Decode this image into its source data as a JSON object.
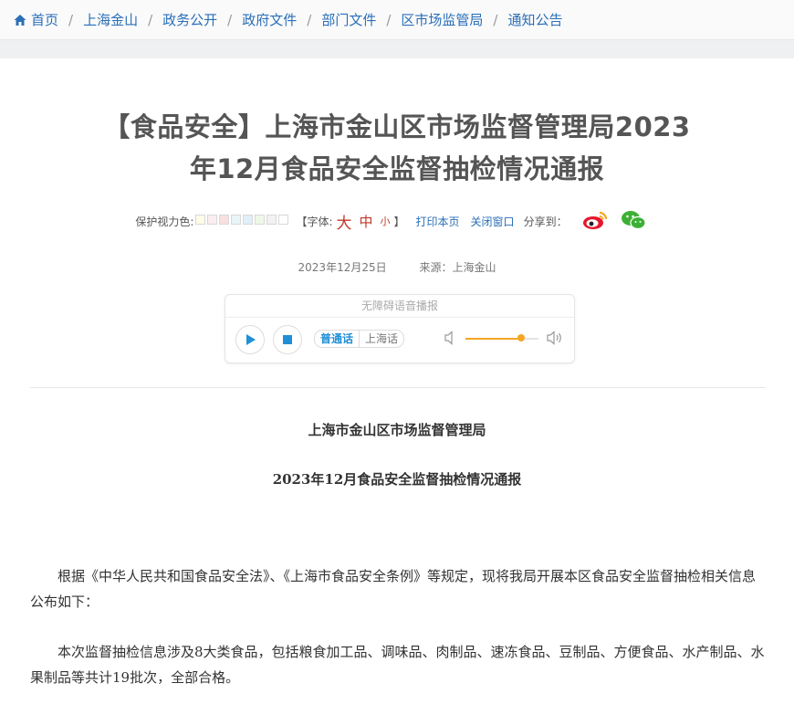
{
  "breadcrumb": {
    "items": [
      "首页",
      "上海金山",
      "政务公开",
      "政府文件",
      "部门文件",
      "区市场监管局",
      "通知公告"
    ],
    "separator": "/"
  },
  "article": {
    "title_line1": "【食品安全】上海市金山区市场监督管理局2023",
    "title_line2": "年12月食品安全监督抽检情况通报",
    "toolbar": {
      "eye_label": "保护视力色:",
      "swatch_colors": [
        "#fffde8",
        "#fbeef0",
        "#f8e0e0",
        "#e8f4f8",
        "#e0f0f8",
        "#eef8e8",
        "#f2f2f2",
        "#ffffff"
      ],
      "font_prefix": "【字体:",
      "font_big": "大",
      "font_mid": "中",
      "font_small": "小",
      "font_suffix": "】",
      "print_label": "打印本页",
      "close_label": "关闭窗口",
      "share_label": "分享到："
    },
    "date": "2023年12月25日",
    "source": "来源：上海金山",
    "player": {
      "header": "无障碍语音播报",
      "dialect_active": "普通话",
      "dialect_other": "上海话",
      "volume_level": 0.76
    },
    "doc_heading1": "上海市金山区市场监督管理局",
    "doc_heading2": "2023年12月食品安全监督抽检情况通报",
    "paragraph1": "根据《中华人民共和国食品安全法》、《上海市食品安全条例》等规定，现将我局开展本区食品安全监督抽检相关信息公布如下：",
    "paragraph2": "本次监督抽检信息涉及8大类食品，包括粮食加工品、调味品、肉制品、速冻食品、豆制品、方便食品、水产制品、水果制品等共计19批次，全部合格。"
  },
  "colors": {
    "link": "#2a6fb8",
    "font_size_red": "#c0392b",
    "player_accent": "#1f8fd8",
    "volume": "#f5a623"
  },
  "icons": [
    "home-icon",
    "weibo-icon",
    "wechat-icon",
    "play-icon",
    "stop-icon",
    "volume-low-icon",
    "volume-high-icon"
  ]
}
